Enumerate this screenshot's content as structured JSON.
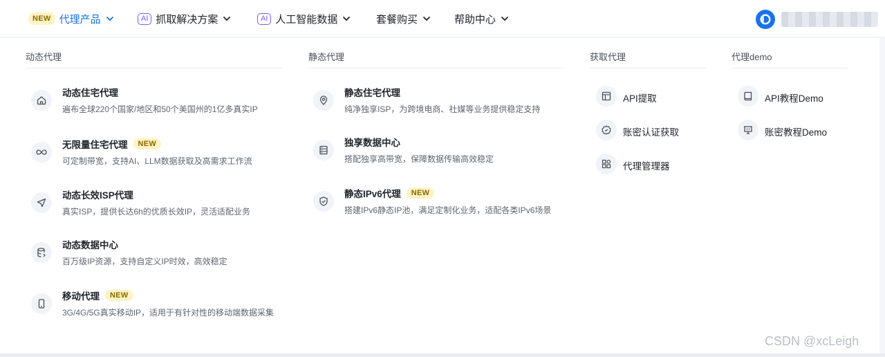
{
  "nav": {
    "items": [
      {
        "badge": "NEW",
        "label": "代理产品"
      },
      {
        "badge": "AI",
        "label": "抓取解决方案"
      },
      {
        "badge": "AI",
        "label": "人工智能数据"
      },
      {
        "badge": "",
        "label": "套餐购买"
      },
      {
        "badge": "",
        "label": "帮助中心"
      }
    ]
  },
  "colors": {
    "accent": "#1a73e8",
    "ai": "#7b5cf5",
    "new_bg": "#fdf3c4"
  },
  "columns": {
    "dynamic": {
      "title": "动态代理",
      "items": [
        {
          "icon": "home-icon",
          "title": "动态住宅代理",
          "badge": "",
          "desc": "遍布全球220个国家/地区和50个美国州的1亿多真实IP"
        },
        {
          "icon": "infinity-icon",
          "title": "无限量住宅代理",
          "badge": "NEW",
          "desc": "可定制带宽，支持AI、LLM数据获取及高需求工作流"
        },
        {
          "icon": "send-icon",
          "title": "动态长效ISP代理",
          "badge": "",
          "desc": "真实ISP，提供长达6h的优质长效IP，灵活适配业务"
        },
        {
          "icon": "database-icon",
          "title": "动态数据中心",
          "badge": "",
          "desc": "百万级IP资源，支持自定义IP时效，高效稳定"
        },
        {
          "icon": "mobile-icon",
          "title": "移动代理",
          "badge": "NEW",
          "desc": "3G/4G/5G真实移动IP，适用于有针对性的移动端数据采集"
        }
      ]
    },
    "static": {
      "title": "静态代理",
      "items": [
        {
          "icon": "location-pin-icon",
          "title": "静态住宅代理",
          "badge": "",
          "desc": "纯净独享ISP，为跨境电商、社媒等业务提供稳定支持"
        },
        {
          "icon": "server-icon",
          "title": "独享数据中心",
          "badge": "",
          "desc": "搭配独享高带宽，保障数据传输高效稳定"
        },
        {
          "icon": "shield-icon",
          "title": "静态IPv6代理",
          "badge": "NEW",
          "desc": "搭建IPv6静态IP池，满足定制化业务，适配各类IPv6场景"
        }
      ]
    },
    "fetch": {
      "title": "获取代理",
      "items": [
        {
          "icon": "api-window-icon",
          "label": "API提取"
        },
        {
          "icon": "gear-badge-icon",
          "label": "账密认证获取"
        },
        {
          "icon": "grid-icon",
          "label": "代理管理器"
        }
      ]
    },
    "demo": {
      "title": "代理demo",
      "items": [
        {
          "icon": "book-icon",
          "label": "API教程Demo"
        },
        {
          "icon": "presentation-icon",
          "label": "账密教程Demo"
        }
      ]
    }
  },
  "watermark": "CSDN @xcLeigh"
}
